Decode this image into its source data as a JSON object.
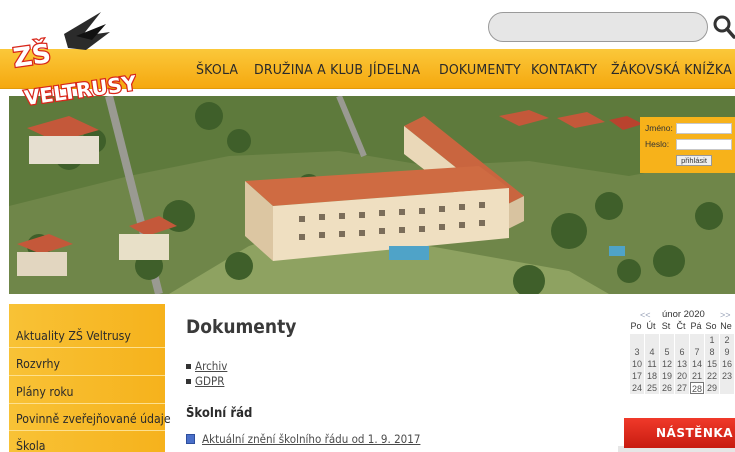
{
  "search": {
    "placeholder": ""
  },
  "logo": {
    "text_line1": "ZŠ",
    "text_line2": "VELTRUSY"
  },
  "nav": [
    {
      "label": "ŠKOLA"
    },
    {
      "label": "DRUŽINA A KLUB"
    },
    {
      "label": "JÍDELNA"
    },
    {
      "label": "DOKUMENTY"
    },
    {
      "label": "KONTAKTY"
    },
    {
      "label": "ŽÁKOVSKÁ KNÍŽKA"
    }
  ],
  "login": {
    "name_label": "Jméno:",
    "password_label": "Heslo:",
    "submit_label": "přihlásit"
  },
  "sidebar": [
    {
      "label": "Aktuality ZŠ Veltrusy"
    },
    {
      "label": "Rozvrhy"
    },
    {
      "label": "Plány roku"
    },
    {
      "label": "Povinně zveřejňované údaje"
    },
    {
      "label": "Škola"
    }
  ],
  "main": {
    "title": "Dokumenty",
    "links": [
      {
        "label": "Archiv"
      },
      {
        "label": "GDPR"
      }
    ],
    "section_title": "Školní řád",
    "file_link": "Aktuální znění školního řádu od 1. 9. 2017"
  },
  "calendar": {
    "prev": "<<",
    "next": ">>",
    "title": "únor 2020",
    "weekdays": [
      "Po",
      "Út",
      "St",
      "Čt",
      "Pá",
      "So",
      "Ne"
    ],
    "rows": [
      [
        "",
        "",
        "",
        "",
        "",
        "1",
        "2"
      ],
      [
        "3",
        "4",
        "5",
        "6",
        "7",
        "8",
        "9"
      ],
      [
        "10",
        "11",
        "12",
        "13",
        "14",
        "15",
        "16"
      ],
      [
        "17",
        "18",
        "19",
        "20",
        "21",
        "22",
        "23"
      ],
      [
        "24",
        "25",
        "26",
        "27",
        "28",
        "29",
        ""
      ]
    ],
    "today": "28"
  },
  "board": {
    "label": "NÁSTĚNKA"
  },
  "colors": {
    "accent": "#f6b21c",
    "board": "#d8261a",
    "nav_text": "#2a2a2a"
  }
}
